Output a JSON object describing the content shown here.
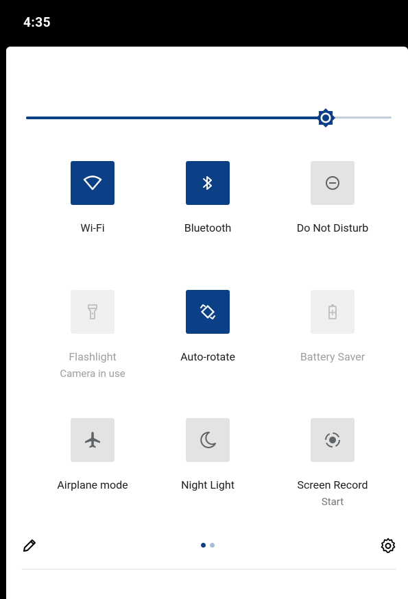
{
  "status_bar": {
    "time": "4:35"
  },
  "brightness": {
    "level_percent": 82
  },
  "tiles": [
    {
      "name": "wifi",
      "label": "Wi-Fi",
      "sublabel": "",
      "state": "on",
      "icon": "wifi-icon"
    },
    {
      "name": "bluetooth",
      "label": "Bluetooth",
      "sublabel": "",
      "state": "on",
      "icon": "bluetooth-icon"
    },
    {
      "name": "do-not-disturb",
      "label": "Do Not Disturb",
      "sublabel": "",
      "state": "off",
      "icon": "do-not-disturb-icon"
    },
    {
      "name": "flashlight",
      "label": "Flashlight",
      "sublabel": "Camera in use",
      "state": "unavailable",
      "icon": "flashlight-icon"
    },
    {
      "name": "auto-rotate",
      "label": "Auto-rotate",
      "sublabel": "",
      "state": "on",
      "icon": "auto-rotate-icon"
    },
    {
      "name": "battery-saver",
      "label": "Battery Saver",
      "sublabel": "",
      "state": "unavailable",
      "icon": "battery-saver-icon"
    },
    {
      "name": "airplane-mode",
      "label": "Airplane mode",
      "sublabel": "",
      "state": "off",
      "icon": "airplane-icon"
    },
    {
      "name": "night-light",
      "label": "Night Light",
      "sublabel": "",
      "state": "off",
      "icon": "moon-icon"
    },
    {
      "name": "screen-record",
      "label": "Screen Record",
      "sublabel": "Start",
      "state": "off",
      "icon": "screen-record-icon"
    }
  ],
  "footer": {
    "page_count": 2,
    "active_page": 1
  },
  "colors": {
    "accent": "#0b3f86",
    "tile_off": "#e3e3e3",
    "icon_off": "#5f6368"
  }
}
